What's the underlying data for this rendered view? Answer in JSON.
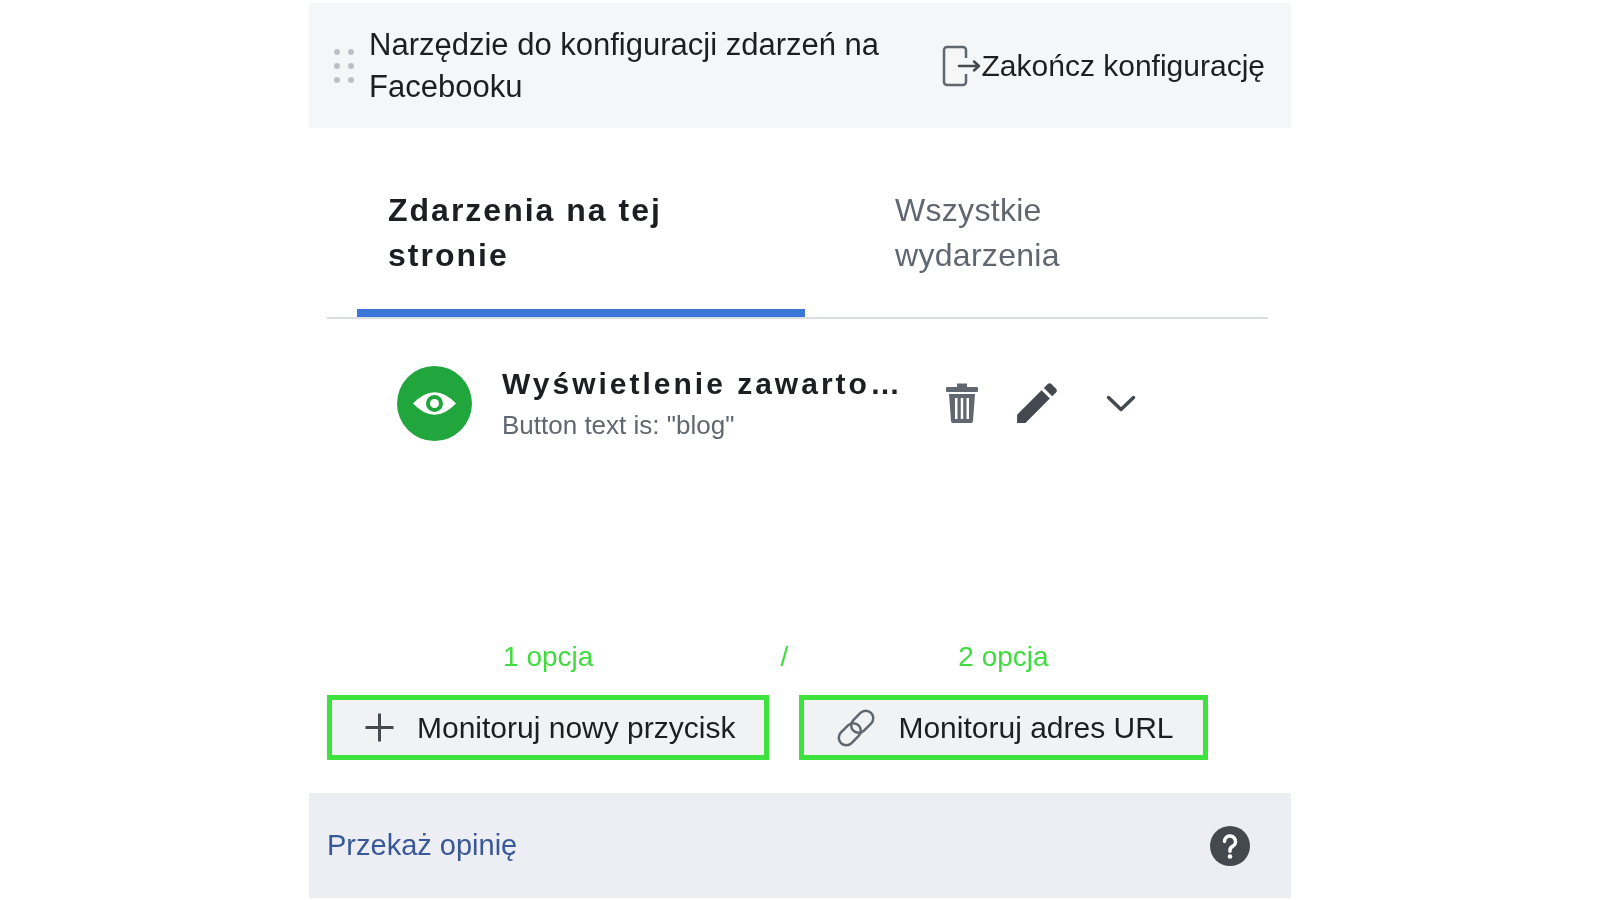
{
  "header": {
    "title": "Narzędzie do konfiguracji zdarzeń na Facebooku",
    "exit_button": "Zakończ konfigurację"
  },
  "tabs": [
    {
      "label": "Zdarzenia na tej stronie",
      "selected": true
    },
    {
      "label": "Wszystkie wydarzenia",
      "selected": false
    }
  ],
  "events": [
    {
      "title": "Wyświetlenie zawarto…",
      "description": "Button text is: \"blog\""
    }
  ],
  "option_labels": [
    "1 opcja",
    "/",
    "2 opcja"
  ],
  "actions": [
    {
      "kind": "add",
      "label": "Monitoruj nowy przycisk",
      "highlighted": true
    },
    {
      "kind": "link",
      "label": "Monitoruj adres URL",
      "highlighted": true
    }
  ],
  "footer": {
    "feedback_link": "Przekaż opinię"
  }
}
